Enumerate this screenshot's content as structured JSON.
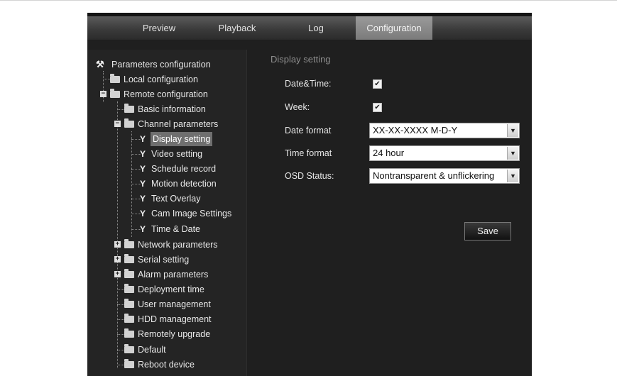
{
  "tabs": {
    "preview": "Preview",
    "playback": "Playback",
    "log": "Log",
    "configuration": "Configuration",
    "active": "Configuration"
  },
  "tree": {
    "root": "Parameters configuration",
    "local": "Local configuration",
    "remote": "Remote configuration",
    "basic": "Basic information",
    "channel": "Channel parameters",
    "channel_children": {
      "display": "Display setting",
      "video": "Video setting",
      "schedule": "Schedule record",
      "motion": "Motion detection",
      "overlay": "Text Overlay",
      "cam_image": "Cam Image Settings",
      "time_date": "Time & Date"
    },
    "network": "Network parameters",
    "serial": "Serial setting",
    "alarm": "Alarm parameters",
    "deployment": "Deployment time",
    "user": "User management",
    "hdd": "HDD management",
    "upgrade": "Remotely upgrade",
    "default": "Default",
    "reboot": "Reboot device",
    "selected": "Display setting"
  },
  "display_setting": {
    "title": "Display setting",
    "date_time_label": "Date&Time:",
    "date_time_checked": true,
    "week_label": "Week:",
    "week_checked": true,
    "date_format_label": "Date format",
    "date_format_value": "XX-XX-XXXX M-D-Y",
    "time_format_label": "Time format",
    "time_format_value": "24 hour",
    "osd_status_label": "OSD Status:",
    "osd_status_value": "Nontransparent & unflickering",
    "save_label": "Save",
    "check_glyph": "✔",
    "arrow_glyph": "▼"
  },
  "icons": {
    "root": "wrench-pair-icon",
    "folder": "folder-icon",
    "setting": "wrench-icon",
    "expand": "plus-icon",
    "collapse": "minus-icon"
  },
  "colors": {
    "app_bg": "#1f1f1f",
    "active_tab": "#8a8a8a",
    "selected_item": "#6f6f6f"
  }
}
